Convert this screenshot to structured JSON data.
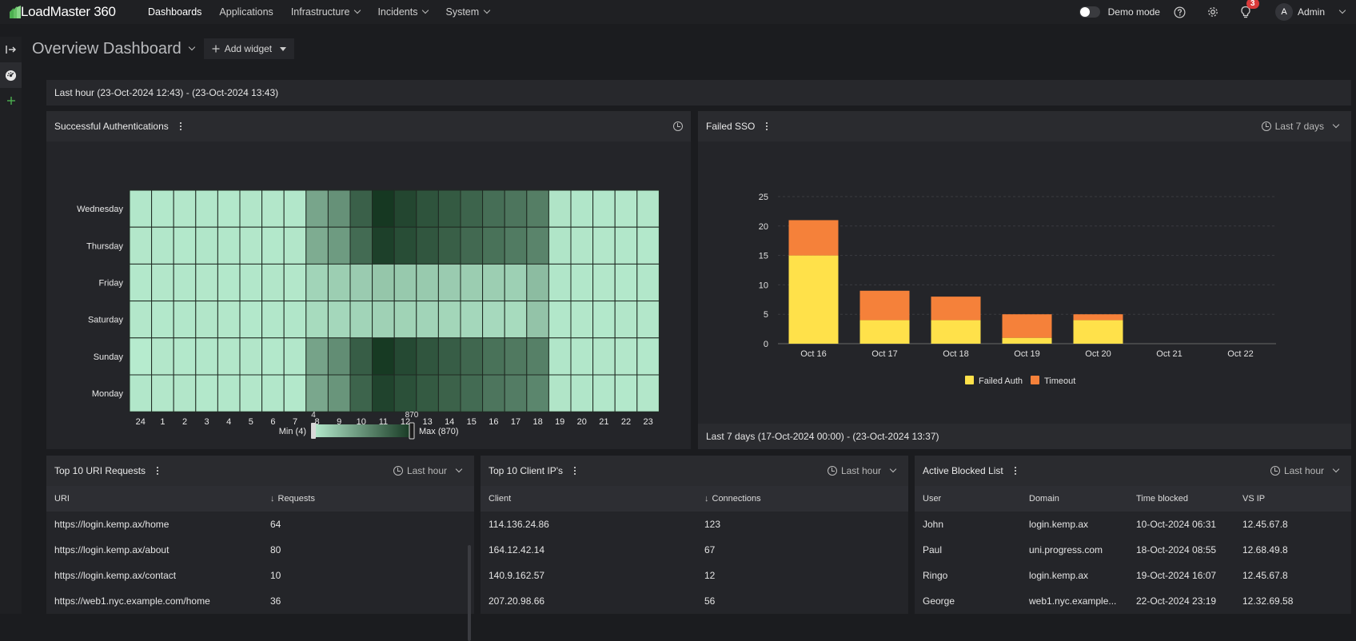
{
  "app": {
    "name": "LoadMaster 360"
  },
  "nav": [
    {
      "label": "Dashboards",
      "dropdown": false
    },
    {
      "label": "Applications",
      "dropdown": false
    },
    {
      "label": "Infrastructure",
      "dropdown": true
    },
    {
      "label": "Incidents",
      "dropdown": true
    },
    {
      "label": "System",
      "dropdown": true
    }
  ],
  "topbar": {
    "demo_mode_label": "Demo mode",
    "notifications_count": "3",
    "user_initial": "A",
    "user_name": "Admin"
  },
  "page": {
    "title": "Overview Dashboard",
    "add_widget_label": "Add widget",
    "range_label": "Last hour (23-Oct-2024 12:43) - (23-Oct-2024 13:43)"
  },
  "colors": {
    "accent_green": "#4caf50",
    "failed_auth": "#ffe14a",
    "timeout": "#f5813a",
    "badge_red": "#d93a3a"
  },
  "auth_panel": {
    "title": "Successful Authentications",
    "legend": {
      "min_value": "4",
      "max_value": "870",
      "min_label": "Min (4)",
      "max_label": "Max (870)"
    }
  },
  "sso_panel": {
    "title": "Failed SSO",
    "range": "Last 7 days",
    "footer": "Last 7 days (17-Oct-2024 00:00) - (23-Oct-2024 13:37)"
  },
  "chart_data": [
    {
      "type": "heatmap",
      "title": "Successful Authentications",
      "y_categories": [
        "Wednesday",
        "Thursday",
        "Friday",
        "Saturday",
        "Sunday",
        "Monday"
      ],
      "x_categories": [
        "24",
        "1",
        "2",
        "3",
        "4",
        "5",
        "6",
        "7",
        "8",
        "9",
        "10",
        "11",
        "12",
        "13",
        "14",
        "15",
        "16",
        "17",
        "18",
        "19",
        "20",
        "21",
        "22",
        "23"
      ],
      "values": [
        [
          10,
          8,
          9,
          10,
          8,
          11,
          9,
          10,
          250,
          350,
          620,
          870,
          780,
          700,
          660,
          600,
          540,
          500,
          450,
          15,
          12,
          10,
          9,
          11
        ],
        [
          9,
          10,
          8,
          12,
          10,
          9,
          8,
          11,
          220,
          300,
          560,
          820,
          740,
          680,
          630,
          570,
          520,
          470,
          420,
          14,
          11,
          9,
          10,
          8
        ],
        [
          8,
          9,
          10,
          9,
          8,
          10,
          11,
          9,
          60,
          80,
          90,
          110,
          100,
          95,
          90,
          85,
          80,
          75,
          150,
          12,
          10,
          9,
          8,
          10
        ],
        [
          9,
          8,
          10,
          11,
          9,
          8,
          10,
          12,
          40,
          50,
          60,
          70,
          65,
          60,
          55,
          50,
          45,
          40,
          120,
          10,
          9,
          8,
          11,
          9
        ],
        [
          4,
          9,
          8,
          10,
          9,
          11,
          8,
          10,
          260,
          370,
          640,
          860,
          760,
          690,
          640,
          580,
          520,
          480,
          440,
          12,
          10,
          11,
          9,
          8
        ],
        [
          10,
          9,
          11,
          8,
          10,
          9,
          10,
          8,
          240,
          330,
          600,
          800,
          720,
          660,
          610,
          560,
          500,
          460,
          410,
          13,
          12,
          10,
          8,
          9
        ]
      ],
      "min": 4,
      "max": 870
    },
    {
      "type": "bar",
      "stacked": true,
      "title": "Failed SSO",
      "categories": [
        "Oct 16",
        "Oct 17",
        "Oct 18",
        "Oct 19",
        "Oct 20",
        "Oct 21",
        "Oct 22"
      ],
      "series": [
        {
          "name": "Failed Auth",
          "values": [
            15,
            4,
            4,
            1,
            4,
            0,
            0
          ]
        },
        {
          "name": "Timeout",
          "values": [
            6,
            5,
            4,
            4,
            1,
            0,
            0
          ]
        }
      ],
      "ylim": [
        0,
        25
      ],
      "yticks": [
        "0",
        "5",
        "10",
        "15",
        "20",
        "25"
      ],
      "grid": true,
      "legend": "bottom"
    }
  ],
  "uri_panel": {
    "title": "Top 10 URI Requests",
    "range": "Last hour",
    "columns": [
      "URI",
      "Requests"
    ],
    "rows": [
      [
        "https://login.kemp.ax/home",
        "64"
      ],
      [
        "https://login.kemp.ax/about",
        "80"
      ],
      [
        "https://login.kemp.ax/contact",
        "10"
      ],
      [
        "https://web1.nyc.example.com/home",
        "36"
      ]
    ]
  },
  "ip_panel": {
    "title": "Top 10 Client IP's",
    "range": "Last hour",
    "columns": [
      "Client",
      "Connections"
    ],
    "rows": [
      [
        "114.136.24.86",
        "123"
      ],
      [
        "164.12.42.14",
        "67"
      ],
      [
        "140.9.162.57",
        "12"
      ],
      [
        "207.20.98.66",
        "56"
      ]
    ]
  },
  "blocked_panel": {
    "title": "Active Blocked List",
    "range": "Last hour",
    "columns": [
      "User",
      "Domain",
      "Time blocked",
      "VS IP"
    ],
    "rows": [
      [
        "John",
        "login.kemp.ax",
        "10-Oct-2024 06:31",
        "12.45.67.8"
      ],
      [
        "Paul",
        "uni.progress.com",
        "18-Oct-2024 08:55",
        "12.68.49.8"
      ],
      [
        "Ringo",
        "login.kemp.ax",
        "19-Oct-2024 16:07",
        "12.45.67.8"
      ],
      [
        "George",
        "web1.nyc.example...",
        "22-Oct-2024 23:19",
        "12.32.69.58"
      ]
    ]
  }
}
